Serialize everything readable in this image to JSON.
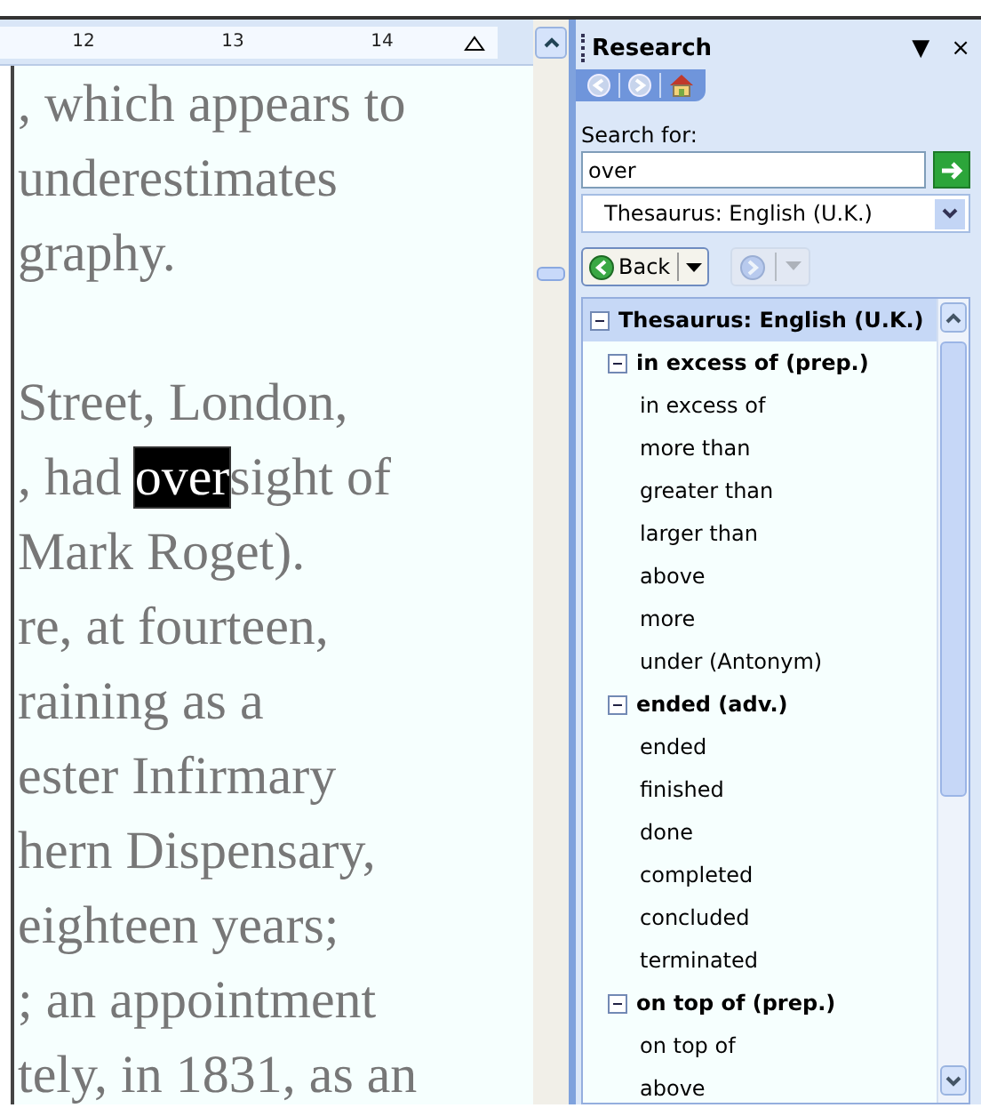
{
  "ruler": {
    "numbers": [
      "12",
      "13",
      "14"
    ]
  },
  "document": {
    "lines": [
      {
        "text": ", which appears to"
      },
      {
        "text": "underestimates"
      },
      {
        "text": "graphy."
      },
      {
        "text": "Street, London,",
        "new_paragraph": true
      },
      {
        "text": ", had ",
        "highlight": "over",
        "after": "sight of"
      },
      {
        "text": "Mark Roget)."
      },
      {
        "text": "re, at fourteen,"
      },
      {
        "text": "raining as a"
      },
      {
        "text": "ester Infirmary"
      },
      {
        "text": "hern Dispensary,"
      },
      {
        "text": "eighteen years;"
      },
      {
        "text": "; an appointment"
      },
      {
        "text": "tely, in 1831, as an"
      }
    ]
  },
  "research_pane": {
    "title": "Research",
    "menu_glyph": "▼",
    "close_glyph": "×",
    "search_label": "Search for:",
    "search_value": "over",
    "source": "Thesaurus: English (U.K.)",
    "back_label": "Back",
    "forward_disabled": true,
    "tree": [
      {
        "label": "Thesaurus: English (U.K.)",
        "expanded": true,
        "children": [
          {
            "label": "in excess of (prep.)",
            "expanded": true,
            "children": [
              {
                "label": "in excess of"
              },
              {
                "label": "more than"
              },
              {
                "label": "greater than"
              },
              {
                "label": "larger than"
              },
              {
                "label": "above"
              },
              {
                "label": "more"
              },
              {
                "label": "under (Antonym)"
              }
            ]
          },
          {
            "label": "ended (adv.)",
            "expanded": true,
            "children": [
              {
                "label": "ended"
              },
              {
                "label": "finished"
              },
              {
                "label": "done"
              },
              {
                "label": "completed"
              },
              {
                "label": "concluded"
              },
              {
                "label": "terminated"
              }
            ]
          },
          {
            "label": "on top of (prep.)",
            "expanded": true,
            "children": [
              {
                "label": "on top of"
              },
              {
                "label": "above"
              }
            ]
          }
        ]
      }
    ]
  }
}
